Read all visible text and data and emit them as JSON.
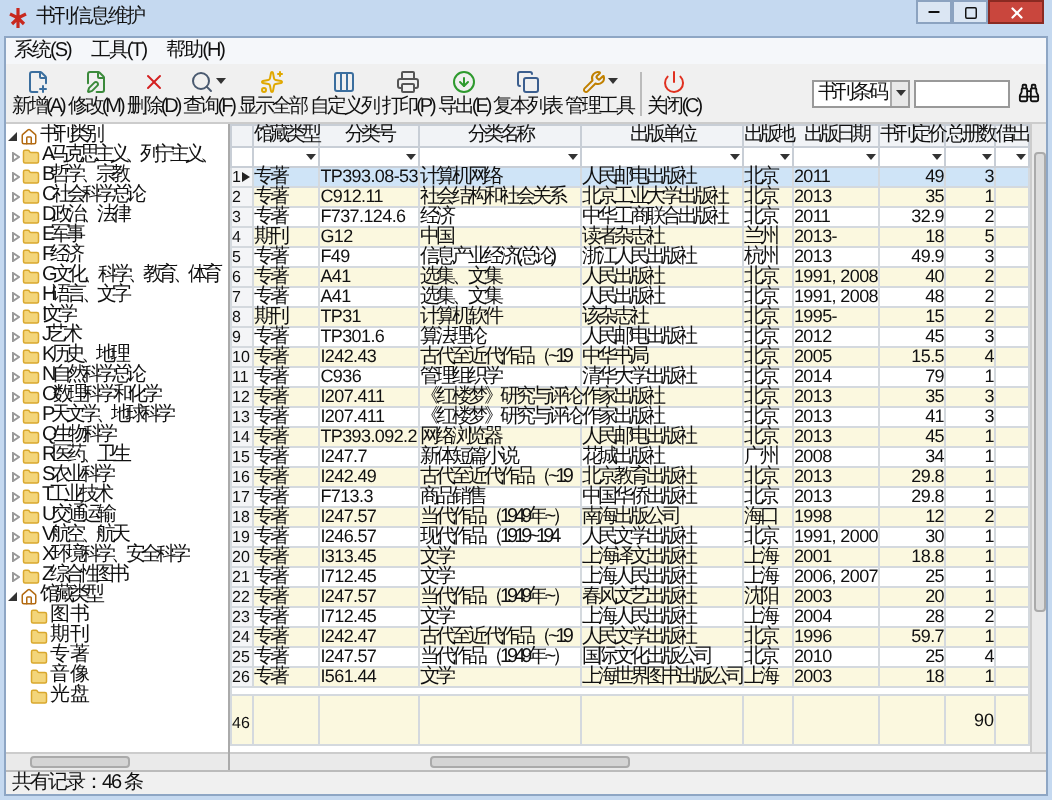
{
  "window": {
    "title": "书刊信息维护"
  },
  "menu": [
    "系统(S)",
    "工具(T)",
    "帮助(H)"
  ],
  "toolbar": [
    {
      "label": "新增(A)",
      "dropdown": false
    },
    {
      "label": "修改(M)",
      "dropdown": false
    },
    {
      "label": "删除(D)",
      "dropdown": false
    },
    {
      "label": "查询(F)",
      "dropdown": true
    },
    {
      "label": "显示全部",
      "dropdown": false
    },
    {
      "label": "自定义列",
      "dropdown": false
    },
    {
      "label": "打印(P)",
      "dropdown": false
    },
    {
      "label": "导出(E)",
      "dropdown": false
    },
    {
      "label": "复本列表",
      "dropdown": false
    },
    {
      "label": "管理工具",
      "dropdown": true
    },
    {
      "label": "关闭(C)",
      "dropdown": false
    }
  ],
  "search": {
    "field": "书刊条码"
  },
  "tree": [
    {
      "label": "书刊类别",
      "expanded": true,
      "children": [
        {
          "label": "A 马克思主义、列宁主义、",
          "expanded": false
        },
        {
          "label": "B 哲学、宗教",
          "expanded": false
        },
        {
          "label": "C 社会科学总论",
          "expanded": false
        },
        {
          "label": "D 政治、法律",
          "expanded": false
        },
        {
          "label": "E 军事",
          "expanded": false
        },
        {
          "label": "F 经济",
          "expanded": false
        },
        {
          "label": "G 文化、科学、教育、体育",
          "expanded": false
        },
        {
          "label": "H 语言、文字",
          "expanded": false
        },
        {
          "label": "I 文学",
          "expanded": false
        },
        {
          "label": "J 艺术",
          "expanded": false
        },
        {
          "label": "K 历史、地理",
          "expanded": false
        },
        {
          "label": "N 自然科学总论",
          "expanded": false
        },
        {
          "label": "O 数理科学和化学",
          "expanded": false
        },
        {
          "label": "P 天文学、地球科学",
          "expanded": false
        },
        {
          "label": "Q 生物科学",
          "expanded": false
        },
        {
          "label": "R 医药、卫生",
          "expanded": false
        },
        {
          "label": "S 农业科学",
          "expanded": false
        },
        {
          "label": "T 工业技术",
          "expanded": false
        },
        {
          "label": "U 交通运输",
          "expanded": false
        },
        {
          "label": "V 航空、航天",
          "expanded": false
        },
        {
          "label": "X 环境科学、安全科学",
          "expanded": false
        },
        {
          "label": "Z 综合性图书",
          "expanded": false
        }
      ]
    },
    {
      "label": "馆藏类型",
      "expanded": true,
      "children": [
        {
          "label": "图书"
        },
        {
          "label": "期刊"
        },
        {
          "label": "专著"
        },
        {
          "label": "音像"
        },
        {
          "label": "光盘"
        }
      ]
    }
  ],
  "table": {
    "columns": [
      "馆藏类型",
      "分类号",
      "分类名称",
      "出版单位",
      "出版地",
      "出版日期",
      "书刊定价",
      "总册数",
      "借出"
    ],
    "rows": [
      {
        "number": "1",
        "selected": true,
        "cells": [
          "专著",
          "TP393.08-53",
          "计算机网络",
          "人民邮电出版社",
          "北京",
          "2011",
          "49",
          "3"
        ]
      },
      {
        "number": "2",
        "selected": false,
        "cells": [
          "专著",
          "C912.11",
          "社会结构和社会关系",
          "北京工业大学出版社",
          "北京",
          "2013",
          "35",
          "1"
        ]
      },
      {
        "number": "3",
        "selected": false,
        "cells": [
          "专著",
          "F737.124.6",
          "经济",
          "中华工商联合出版社",
          "北京",
          "2011",
          "32.9",
          "2"
        ]
      },
      {
        "number": "4",
        "selected": false,
        "cells": [
          "期刊",
          "G12",
          "中国",
          "读者杂志社",
          "兰州",
          "2013-",
          "18",
          "5"
        ]
      },
      {
        "number": "5",
        "selected": false,
        "cells": [
          "专著",
          "F49",
          "信息产业经济(总论)",
          "浙江人民出版社",
          "杭州",
          "2013",
          "49.9",
          "3"
        ]
      },
      {
        "number": "6",
        "selected": false,
        "cells": [
          "专著",
          "A41",
          "选集、文集",
          "人民出版社",
          "北京",
          "1991, 2008",
          "40",
          "2"
        ]
      },
      {
        "number": "7",
        "selected": false,
        "cells": [
          "专著",
          "A41",
          "选集、文集",
          "人民出版社",
          "北京",
          "1991, 2008",
          "48",
          "2"
        ]
      },
      {
        "number": "8",
        "selected": false,
        "cells": [
          "期刊",
          "TP31",
          "计算机软件",
          "该杂志社",
          "北京",
          "1995-",
          "15",
          "2"
        ]
      },
      {
        "number": "9",
        "selected": false,
        "cells": [
          "专著",
          "TP301.6",
          "算法理论",
          "人民邮电出版社",
          "北京",
          "2012",
          "45",
          "3"
        ]
      },
      {
        "number": "10",
        "selected": false,
        "cells": [
          "专著",
          "I242.43",
          "古代至近代作品（~19",
          "中华书局",
          "北京",
          "2005",
          "15.5",
          "4"
        ]
      },
      {
        "number": "11",
        "selected": false,
        "cells": [
          "专著",
          "C936",
          "管理组织学",
          "清华大学出版社",
          "北京",
          "2014",
          "79",
          "1"
        ]
      },
      {
        "number": "12",
        "selected": false,
        "cells": [
          "专著",
          "I207.411",
          "《红楼梦》研究与评论",
          "作家出版社",
          "北京",
          "2013",
          "35",
          "3"
        ]
      },
      {
        "number": "13",
        "selected": false,
        "cells": [
          "专著",
          "I207.411",
          "《红楼梦》研究与评论",
          "作家出版社",
          "北京",
          "2013",
          "41",
          "3"
        ]
      },
      {
        "number": "14",
        "selected": false,
        "cells": [
          "专著",
          "TP393.092.2",
          "网络浏览器",
          "人民邮电出版社",
          "北京",
          "2013",
          "45",
          "1"
        ]
      },
      {
        "number": "15",
        "selected": false,
        "cells": [
          "专著",
          "I247.7",
          "新体短篇小说",
          "花城出版社",
          "广州",
          "2008",
          "34",
          "1"
        ]
      },
      {
        "number": "16",
        "selected": false,
        "cells": [
          "专著",
          "I242.49",
          "古代至近代作品（~19",
          "北京教育出版社",
          "北京",
          "2013",
          "29.8",
          "1"
        ]
      },
      {
        "number": "17",
        "selected": false,
        "cells": [
          "专著",
          "F713.3",
          "商品销售",
          "中国华侨出版社",
          "北京",
          "2013",
          "29.8",
          "1"
        ]
      },
      {
        "number": "18",
        "selected": false,
        "cells": [
          "专著",
          "I247.57",
          "当代作品（1949年~）",
          "南海出版公司",
          "海口",
          "1998",
          "12",
          "2"
        ]
      },
      {
        "number": "19",
        "selected": false,
        "cells": [
          "专著",
          "I246.57",
          "现代作品（1919~194",
          "人民文学出版社",
          "北京",
          "1991, 2000",
          "30",
          "1"
        ]
      },
      {
        "number": "20",
        "selected": false,
        "cells": [
          "专著",
          "I313.45",
          "文学",
          "上海译文出版社",
          "上海",
          "2001",
          "18.8",
          "1"
        ]
      },
      {
        "number": "21",
        "selected": false,
        "cells": [
          "专著",
          "I712.45",
          "文学",
          "上海人民出版社",
          "上海",
          "2006, 2007",
          "25",
          "1"
        ]
      },
      {
        "number": "22",
        "selected": false,
        "cells": [
          "专著",
          "I247.57",
          "当代作品（1949年~）",
          "春风文艺出版社",
          "沈阳",
          "2003",
          "20",
          "1"
        ]
      },
      {
        "number": "23",
        "selected": false,
        "cells": [
          "专著",
          "I712.45",
          "文学",
          "上海人民出版社",
          "上海",
          "2004",
          "28",
          "2"
        ]
      },
      {
        "number": "24",
        "selected": false,
        "cells": [
          "专著",
          "I242.47",
          "古代至近代作品（~19",
          "人民文学出版社",
          "北京",
          "1996",
          "59.7",
          "1"
        ]
      },
      {
        "number": "25",
        "selected": false,
        "cells": [
          "专著",
          "I247.57",
          "当代作品（1949年~）",
          "国际文化出版公司",
          "北京",
          "2010",
          "25",
          "4"
        ]
      },
      {
        "number": "26",
        "selected": false,
        "cells": [
          "专著",
          "I561.44",
          "文学",
          "上海世界图书出版公司",
          "上海",
          "2003",
          "18",
          "1"
        ]
      }
    ],
    "total": {
      "number": "46",
      "total_copies": "90"
    }
  },
  "status_bar": "共有记录：46 条"
}
